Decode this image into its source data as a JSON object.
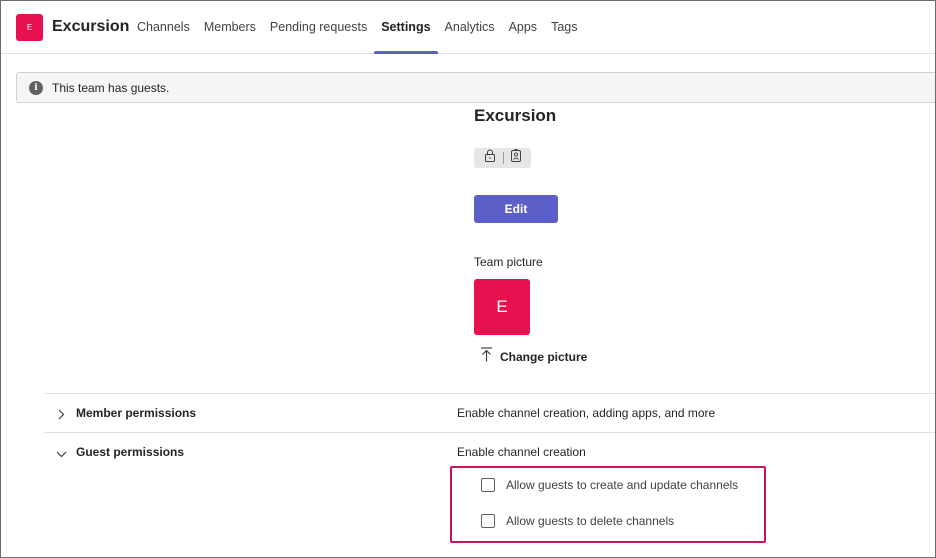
{
  "header": {
    "team_initial": "E",
    "team_name": "Excursion",
    "tabs": [
      {
        "label": "Channels",
        "active": false
      },
      {
        "label": "Members",
        "active": false
      },
      {
        "label": "Pending requests",
        "active": false
      },
      {
        "label": "Settings",
        "active": true
      },
      {
        "label": "Analytics",
        "active": false
      },
      {
        "label": "Apps",
        "active": false
      },
      {
        "label": "Tags",
        "active": false
      }
    ]
  },
  "banner": {
    "icon": "info-icon",
    "text": "This team has guests."
  },
  "main": {
    "title": "Excursion",
    "privacy_icons": [
      "lock-icon",
      "badge-icon"
    ],
    "edit_label": "Edit",
    "team_picture_label": "Team picture",
    "team_picture_initial": "E",
    "change_picture_label": "Change picture"
  },
  "sections": [
    {
      "title": "Member permissions",
      "description": "Enable channel creation, adding apps, and more",
      "expanded": false
    },
    {
      "title": "Guest permissions",
      "description": "Enable channel creation",
      "expanded": true,
      "options": [
        {
          "label": "Allow guests to create and update channels",
          "checked": false
        },
        {
          "label": "Allow guests to delete channels",
          "checked": false
        }
      ]
    }
  ],
  "colors": {
    "accent": "#5b5fc7",
    "team_color": "#e8104f",
    "highlight": "#c2185b"
  }
}
